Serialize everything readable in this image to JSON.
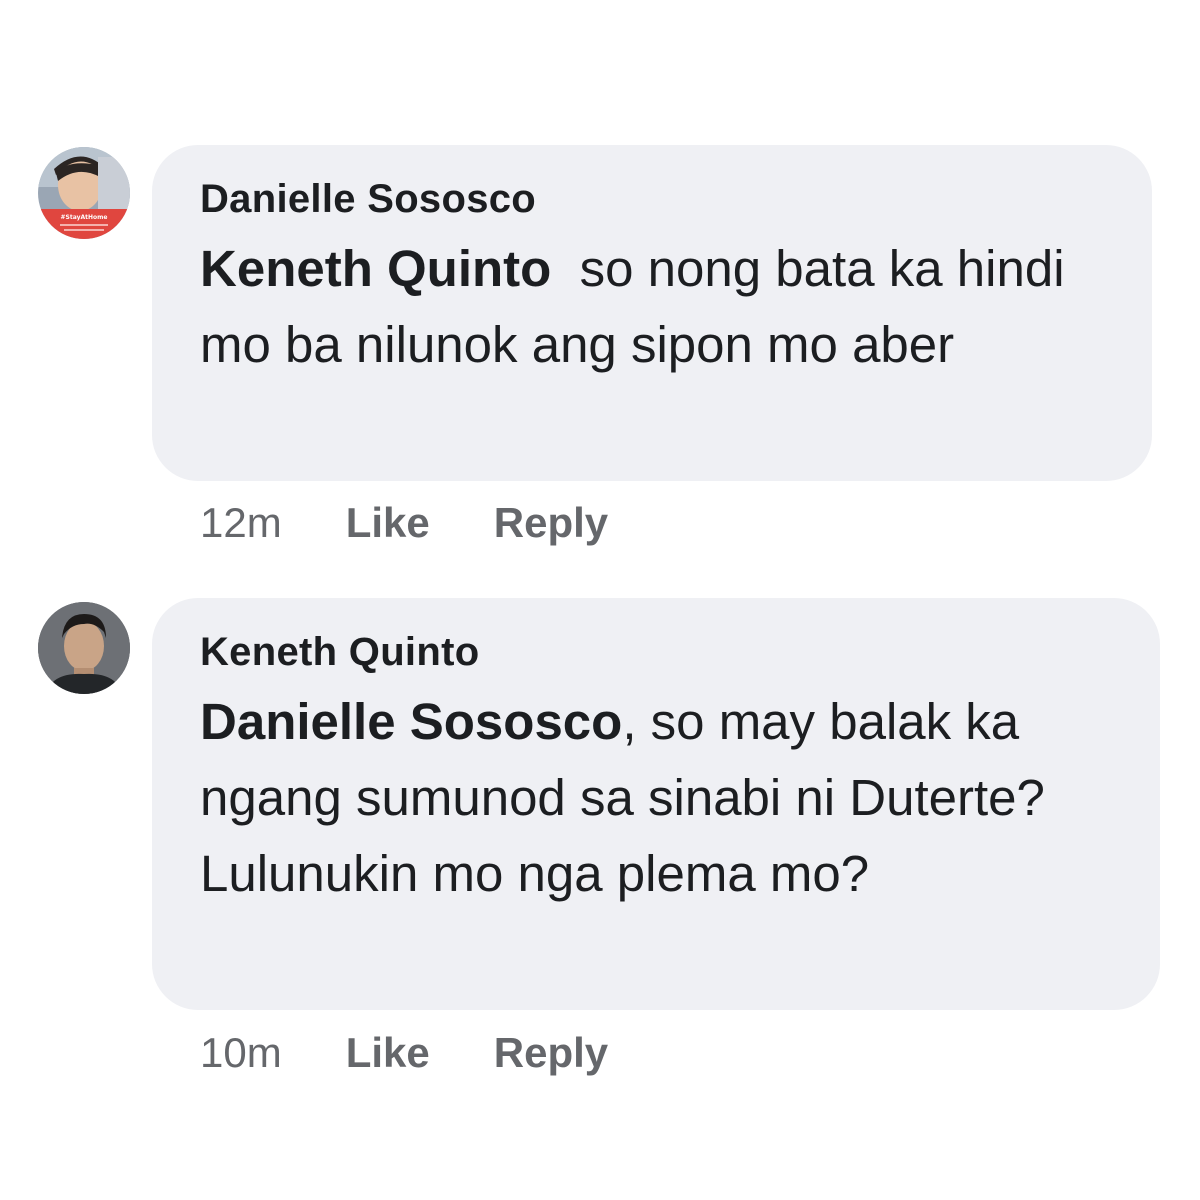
{
  "comments": [
    {
      "author": "Danielle Sososco",
      "mention": "Keneth Quinto",
      "text": "  so nong bata ka hindi mo ba nilunok ang sipon mo aber",
      "time": "12m",
      "like_label": "Like",
      "reply_label": "Reply",
      "avatar_icon": "profile-photo-woman",
      "avatar_badge_text": "#StayAtHome"
    },
    {
      "author": "Keneth Quinto",
      "mention": "Danielle Sososco",
      "text": ", so may balak ka ngang sumunod sa sinabi ni Duterte? Lulunukin mo nga plema mo?",
      "time": "10m",
      "like_label": "Like",
      "reply_label": "Reply",
      "avatar_icon": "profile-photo-man"
    }
  ],
  "colors": {
    "bubble": "#eff0f4",
    "text": "#1c1e21",
    "meta": "#65676b",
    "badge": "#e0463f"
  }
}
